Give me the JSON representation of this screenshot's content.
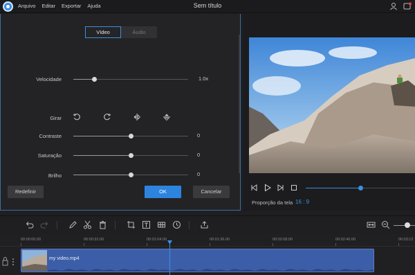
{
  "app": {
    "title": "Sem título",
    "menu": [
      "Arquivo",
      "Editar",
      "Exportar",
      "Ajuda"
    ]
  },
  "settings": {
    "tabs": {
      "video": "Vídeo",
      "audio": "Áudio"
    },
    "rows": [
      {
        "label": "Velocidade",
        "value": "1.0x",
        "level": 0.18
      },
      {
        "label": "Contraste",
        "value": "0",
        "level": 0.5
      },
      {
        "label": "Saturação",
        "value": "0",
        "level": 0.5
      },
      {
        "label": "Brilho",
        "value": "0",
        "level": 0.5
      }
    ],
    "rotate_label": "Girar",
    "buttons": {
      "reset": "Redefinir",
      "ok": "OK",
      "cancel": "Cancelar"
    }
  },
  "preview": {
    "aspect_label": "Proporção da tela",
    "aspect_value": "16 : 9",
    "progress": 0.5
  },
  "timeline": {
    "ticks": [
      "00:00:00.00",
      "00:00:32.00",
      "00:01:04.00",
      "00:01:36.00",
      "00:02:08.00",
      "00:02:40.00",
      "00:03:12"
    ],
    "clip_name": "my video.mp4"
  },
  "colors": {
    "accent": "#2d84df",
    "clip": "#3c5ea8"
  }
}
